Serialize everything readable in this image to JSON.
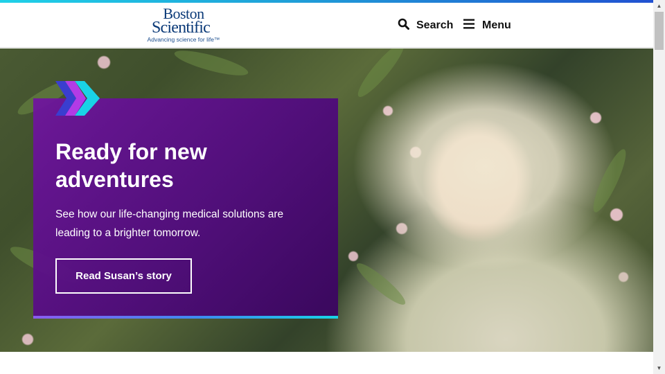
{
  "brand": {
    "name_line1": "Boston",
    "name_line2": "Scientific",
    "tagline": "Advancing science for life™",
    "accent_colors": [
      "#1fd1e8",
      "#2151d1",
      "#6a12a3",
      "#0b3a78"
    ]
  },
  "header": {
    "search_label": "Search",
    "search_icon": "magnifier",
    "menu_label": "Menu",
    "menu_icon": "hamburger"
  },
  "hero": {
    "headline": "Ready for new adventures",
    "subtext": "See how our life-changing medical solutions are leading to a brighter tomorrow.",
    "cta_label": "Read Susan’s story",
    "decor_icon": "triple-chevron-right",
    "photo": "smiling older woman with white hair among flowering shrubs"
  }
}
